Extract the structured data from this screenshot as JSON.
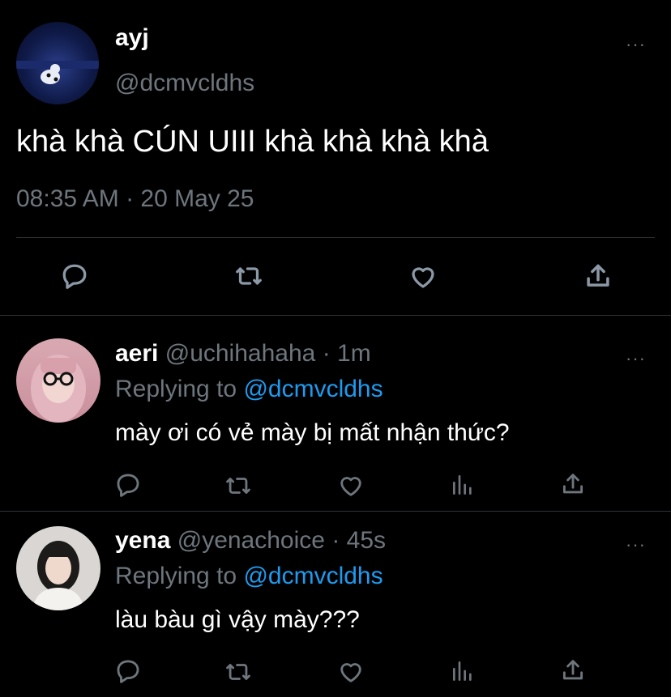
{
  "main_tweet": {
    "display_name": "ayj",
    "handle": "@dcmvcldhs",
    "text": "khà khà CÚN UIII khà khà khà khà",
    "timestamp": "08:35 AM · 20 May 25",
    "more_label": "···"
  },
  "replies": [
    {
      "display_name": "aeri",
      "handle": "@uchihahaha",
      "time": "· 1m",
      "replying_prefix": "Replying to",
      "replying_handle": "@dcmvcldhs",
      "text": "mày ơi có vẻ mày bị mất nhận thức?",
      "more_label": "···"
    },
    {
      "display_name": "yena",
      "handle": "@yenachoice",
      "time": "· 45s",
      "replying_prefix": "Replying to",
      "replying_handle": "@dcmvcldhs",
      "text": "làu bàu gì vậy mày???",
      "more_label": "···"
    }
  ],
  "icons": [
    "reply-icon",
    "retweet-icon",
    "like-icon",
    "share-icon",
    "analytics-icon",
    "more-icon"
  ],
  "colors": {
    "background": "#000000",
    "accent": "#1d9bf0",
    "secondary_text": "#6e767d",
    "divider": "#2f3336"
  }
}
